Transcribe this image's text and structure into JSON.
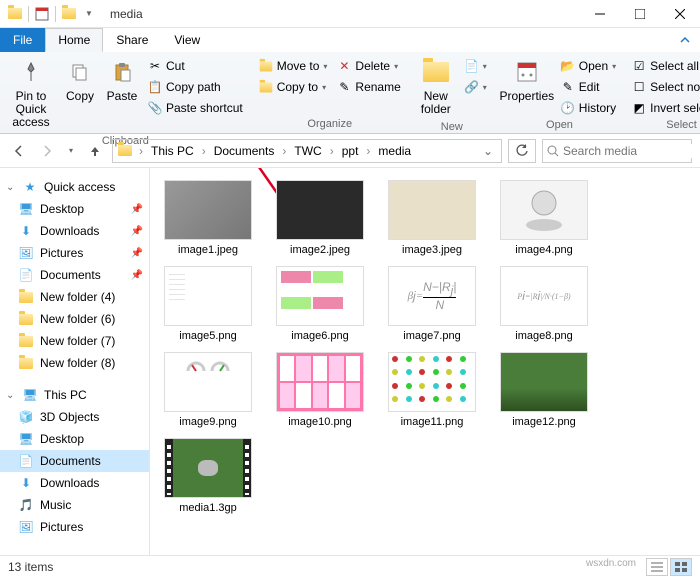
{
  "window": {
    "title": "media"
  },
  "tabs": {
    "file": "File",
    "home": "Home",
    "share": "Share",
    "view": "View"
  },
  "ribbon": {
    "clipboard": {
      "label": "Clipboard",
      "pin": "Pin to Quick access",
      "copy": "Copy",
      "paste": "Paste",
      "cut": "Cut",
      "copy_path": "Copy path",
      "paste_shortcut": "Paste shortcut"
    },
    "organize": {
      "label": "Organize",
      "move_to": "Move to",
      "copy_to": "Copy to",
      "delete": "Delete",
      "rename": "Rename"
    },
    "new": {
      "label": "New",
      "new_folder": "New folder"
    },
    "open": {
      "label": "Open",
      "properties": "Properties",
      "open": "Open",
      "edit": "Edit",
      "history": "History"
    },
    "select": {
      "label": "Select",
      "all": "Select all",
      "none": "Select none",
      "invert": "Invert selection"
    }
  },
  "breadcrumb": {
    "segments": [
      "This PC",
      "Documents",
      "TWC",
      "ppt",
      "media"
    ]
  },
  "search": {
    "placeholder": "Search media"
  },
  "sidebar": {
    "quick": {
      "label": "Quick access",
      "items": [
        {
          "label": "Desktop",
          "icon": "desktop",
          "pinned": true
        },
        {
          "label": "Downloads",
          "icon": "downloads",
          "pinned": true
        },
        {
          "label": "Pictures",
          "icon": "pictures",
          "pinned": true
        },
        {
          "label": "Documents",
          "icon": "documents",
          "pinned": true
        },
        {
          "label": "New folder (4)",
          "icon": "folder",
          "pinned": false
        },
        {
          "label": "New folder (6)",
          "icon": "folder",
          "pinned": false
        },
        {
          "label": "New folder (7)",
          "icon": "folder",
          "pinned": false
        },
        {
          "label": "New folder (8)",
          "icon": "folder",
          "pinned": false
        }
      ]
    },
    "thispc": {
      "label": "This PC",
      "items": [
        {
          "label": "3D Objects",
          "icon": "3d"
        },
        {
          "label": "Desktop",
          "icon": "desktop"
        },
        {
          "label": "Documents",
          "icon": "documents",
          "active": true
        },
        {
          "label": "Downloads",
          "icon": "downloads"
        },
        {
          "label": "Music",
          "icon": "music"
        },
        {
          "label": "Pictures",
          "icon": "pictures"
        }
      ]
    }
  },
  "files": [
    {
      "name": "image1.jpeg",
      "thumb": "gray"
    },
    {
      "name": "image2.jpeg",
      "thumb": "dark"
    },
    {
      "name": "image3.jpeg",
      "thumb": "paper"
    },
    {
      "name": "image4.png",
      "thumb": "stamp"
    },
    {
      "name": "image5.png",
      "thumb": "doc"
    },
    {
      "name": "image6.png",
      "thumb": "diagram"
    },
    {
      "name": "image7.png",
      "thumb": "formula"
    },
    {
      "name": "image8.png",
      "thumb": "formula2"
    },
    {
      "name": "image9.png",
      "thumb": "gauge"
    },
    {
      "name": "image10.png",
      "thumb": "pink"
    },
    {
      "name": "image11.png",
      "thumb": "grid"
    },
    {
      "name": "image12.png",
      "thumb": "nature"
    },
    {
      "name": "media1.3gp",
      "thumb": "video"
    }
  ],
  "status": {
    "count": "13 items"
  },
  "watermark": "wsxdn.com"
}
